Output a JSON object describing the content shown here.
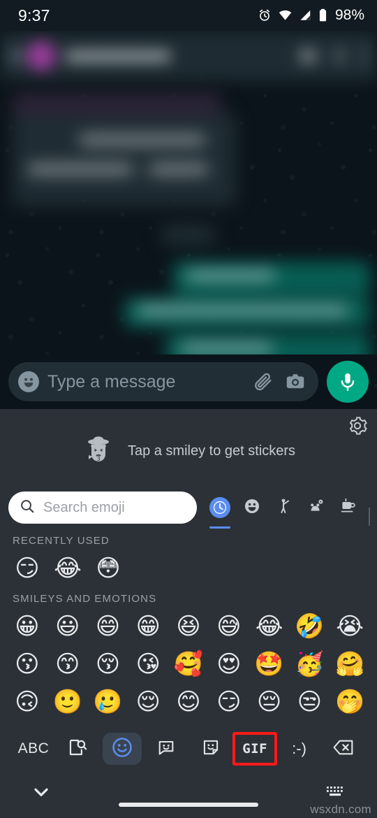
{
  "status_bar": {
    "time": "9:37",
    "battery_percent": "98%",
    "icons": [
      "alarm-icon",
      "wifi-icon",
      "cellular-signal-icon",
      "battery-icon"
    ]
  },
  "chat_header": {
    "blurred": true,
    "back_icon": "back-arrow-icon",
    "avatar": "contact-avatar",
    "avatar_color": "#a13fa1",
    "contact_name": "",
    "actions": [
      "video-call-icon",
      "voice-call-icon",
      "overflow-menu-icon"
    ]
  },
  "conversation": {
    "blurred": true,
    "incoming_bubble_color": "#1f2c33",
    "outgoing_bubble_color": "#075e54",
    "messages": [
      {
        "direction": "incoming",
        "text": ""
      },
      {
        "direction": "incoming",
        "text": ""
      },
      {
        "direction": "outgoing",
        "text": ""
      },
      {
        "direction": "outgoing",
        "text": ""
      },
      {
        "direction": "outgoing",
        "text": ""
      }
    ]
  },
  "input_bar": {
    "placeholder": "Type a message",
    "emoji_button": "emoji-face-icon",
    "attach_button": "paperclip-icon",
    "camera_button": "camera-icon",
    "mic_button": "microphone-icon",
    "mic_button_color": "#00a884"
  },
  "sticker_hint": {
    "text": "Tap a smiley to get stickers",
    "mascot": "cowboy-sticker-icon",
    "settings_icon": "gear-icon"
  },
  "emoji_search": {
    "placeholder": "Search emoji",
    "search_icon": "search-icon"
  },
  "category_tabs": [
    {
      "name": "recent",
      "glyph": "🕐",
      "label": "recently-used",
      "active": true
    },
    {
      "name": "smileys",
      "glyph": "☺",
      "label": "smileys-and-emotions",
      "active": false
    },
    {
      "name": "people",
      "glyph": "🚶",
      "label": "people-and-body",
      "active": false
    },
    {
      "name": "nature",
      "glyph": "🐾",
      "label": "animals-and-nature",
      "active": false
    },
    {
      "name": "food",
      "glyph": "☕",
      "label": "food-and-drink",
      "active": false
    }
  ],
  "sections": [
    {
      "title": "RECENTLY USED",
      "rows": [
        [
          "😏",
          "😂",
          "😳"
        ]
      ]
    },
    {
      "title": "SMILEYS AND EMOTIONS",
      "rows": [
        [
          "😀",
          "😃",
          "😄",
          "😁",
          "😆",
          "😅",
          "😂",
          "🤣",
          "😭"
        ],
        [
          "😗",
          "😙",
          "😚",
          "😘",
          "🥰",
          "😍",
          "🤩",
          "🥳",
          "🤗"
        ],
        [
          "🙃",
          "🙂",
          "🥲",
          "😌",
          "😊",
          "😏",
          "😔",
          "😒",
          "🤭"
        ]
      ]
    }
  ],
  "toolbar": [
    {
      "name": "abc-key",
      "label": "ABC",
      "type": "text",
      "active": false,
      "highlighted": false
    },
    {
      "name": "image-search-button",
      "label": "",
      "type": "image-search-icon",
      "active": false,
      "highlighted": false
    },
    {
      "name": "emoji-button",
      "label": "",
      "type": "emoji-face-icon",
      "active": true,
      "highlighted": false
    },
    {
      "name": "sticker-button",
      "label": "",
      "type": "sticker-bubble-icon",
      "active": false,
      "highlighted": false
    },
    {
      "name": "sticker-pack-button",
      "label": "",
      "type": "sticker-square-icon",
      "active": false,
      "highlighted": false
    },
    {
      "name": "gif-button",
      "label": "GIF",
      "type": "text",
      "active": false,
      "highlighted": true
    },
    {
      "name": "kaomoji-button",
      "label": ":-)",
      "type": "text",
      "active": false,
      "highlighted": false
    },
    {
      "name": "backspace-button",
      "label": "",
      "type": "backspace-icon",
      "active": false,
      "highlighted": false
    }
  ],
  "highlight_color": "#ff1a1a",
  "accent_color": "#5b8def",
  "nav_bar": {
    "hide_keyboard_icon": "chevron-down-icon",
    "home_indicator": "home-indicator",
    "switch_keyboard_icon": "keyboard-icon"
  },
  "watermark": "wsxdn.com"
}
